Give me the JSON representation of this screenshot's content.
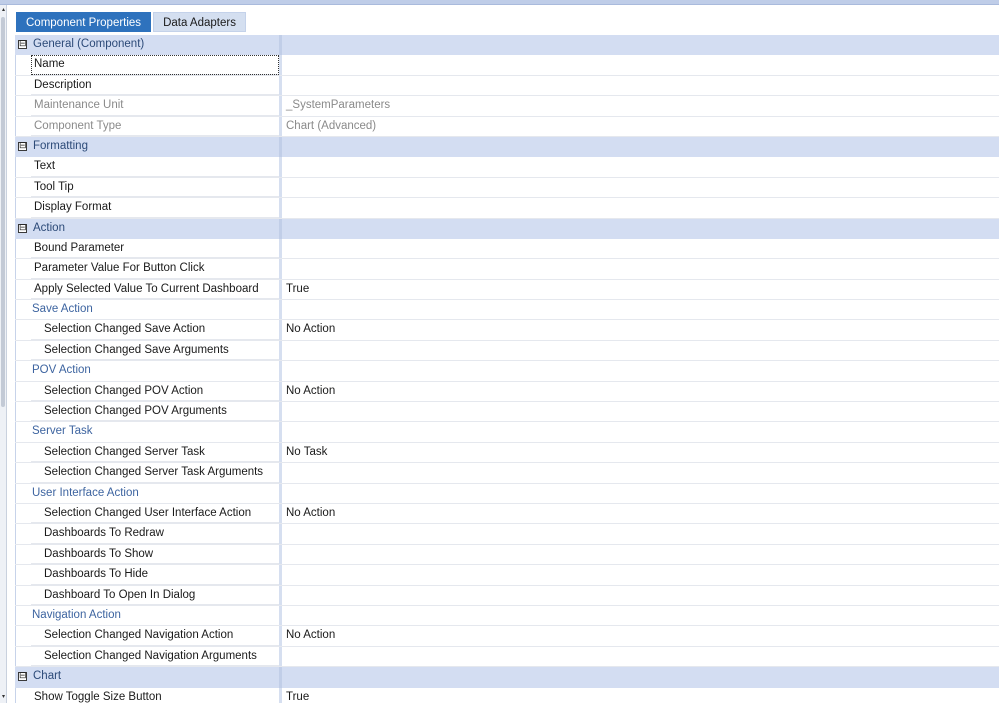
{
  "tabs": [
    {
      "label": "Component Properties",
      "active": true
    },
    {
      "label": "Data Adapters",
      "active": false
    }
  ],
  "rows": [
    {
      "kind": "category",
      "label": "General (Component)",
      "toggle": "⊟"
    },
    {
      "kind": "prop",
      "name": "Name",
      "value": "",
      "selected": true
    },
    {
      "kind": "prop",
      "name": "Description",
      "value": ""
    },
    {
      "kind": "prop",
      "name": "Maintenance Unit",
      "value": "_SystemParameters",
      "readonly": true
    },
    {
      "kind": "prop",
      "name": "Component Type",
      "value": "Chart (Advanced)",
      "readonly": true
    },
    {
      "kind": "category",
      "label": "Formatting",
      "toggle": "⊟"
    },
    {
      "kind": "prop",
      "name": "Text",
      "value": ""
    },
    {
      "kind": "prop",
      "name": "Tool Tip",
      "value": ""
    },
    {
      "kind": "prop",
      "name": "Display Format",
      "value": ""
    },
    {
      "kind": "category",
      "label": "Action",
      "toggle": "⊟"
    },
    {
      "kind": "prop",
      "name": "Bound Parameter",
      "value": ""
    },
    {
      "kind": "prop",
      "name": "Parameter Value For Button Click",
      "value": ""
    },
    {
      "kind": "prop",
      "name": "Apply Selected Value To Current Dashboard",
      "value": "True"
    },
    {
      "kind": "sub",
      "label": "Save Action"
    },
    {
      "kind": "prop",
      "name": "Selection Changed Save Action",
      "value": "No Action",
      "indent": true
    },
    {
      "kind": "prop",
      "name": "Selection Changed Save Arguments",
      "value": "",
      "indent": true
    },
    {
      "kind": "sub",
      "label": "POV Action"
    },
    {
      "kind": "prop",
      "name": "Selection Changed POV Action",
      "value": "No Action",
      "indent": true
    },
    {
      "kind": "prop",
      "name": "Selection Changed POV Arguments",
      "value": "",
      "indent": true
    },
    {
      "kind": "sub",
      "label": "Server Task"
    },
    {
      "kind": "prop",
      "name": "Selection Changed Server Task",
      "value": "No Task",
      "indent": true
    },
    {
      "kind": "prop",
      "name": "Selection Changed Server Task Arguments",
      "value": "",
      "indent": true
    },
    {
      "kind": "sub",
      "label": "User Interface Action"
    },
    {
      "kind": "prop",
      "name": "Selection Changed User Interface Action",
      "value": "No Action",
      "indent": true
    },
    {
      "kind": "prop",
      "name": "Dashboards To Redraw",
      "value": "",
      "indent": true
    },
    {
      "kind": "prop",
      "name": "Dashboards To Show",
      "value": "",
      "indent": true
    },
    {
      "kind": "prop",
      "name": "Dashboards To Hide",
      "value": "",
      "indent": true
    },
    {
      "kind": "prop",
      "name": "Dashboard To Open In Dialog",
      "value": "",
      "indent": true
    },
    {
      "kind": "sub",
      "label": "Navigation Action"
    },
    {
      "kind": "prop",
      "name": "Selection Changed Navigation Action",
      "value": "No Action",
      "indent": true
    },
    {
      "kind": "prop",
      "name": "Selection Changed Navigation Arguments",
      "value": "",
      "indent": true
    },
    {
      "kind": "category",
      "label": "Chart",
      "toggle": "⊟"
    },
    {
      "kind": "prop",
      "name": "Show Toggle Size Button",
      "value": "True"
    }
  ],
  "scrollbar": {
    "up_glyph": "▴",
    "down_glyph": "▾"
  },
  "colors": {
    "tab_active": "#2e72bd",
    "category_band": "#d3ddf2",
    "subcategory_text": "#3d64a0"
  }
}
